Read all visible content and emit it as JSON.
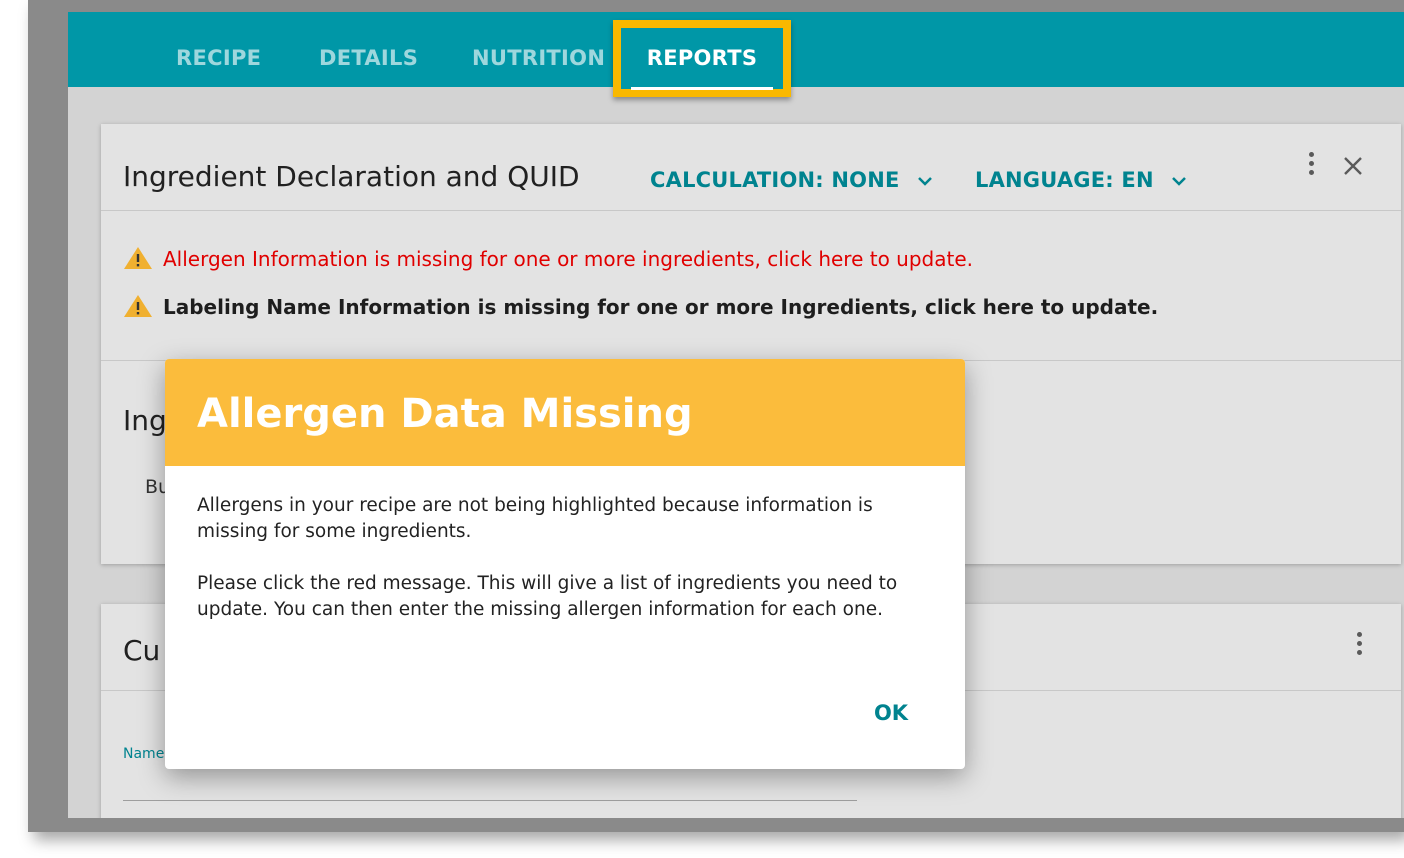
{
  "nav": {
    "tabs": [
      {
        "label": "RECIPE"
      },
      {
        "label": "DETAILS"
      },
      {
        "label": "NUTRITION"
      },
      {
        "label": "REPORTS"
      }
    ],
    "active_tab": "REPORTS"
  },
  "report_card": {
    "title": "Ingredient Declaration and QUID",
    "calculation_label": "CALCULATION: NONE",
    "language_label": "LANGUAGE: EN",
    "warnings": [
      {
        "text": "Allergen Information is missing for one or more ingredients, click here to update.",
        "color": "#e00000"
      },
      {
        "text": "Labeling Name Information is missing for one or more Ingredients, click here to update.",
        "color": "#1e1e1e"
      }
    ],
    "section_title_partial": "Ing",
    "section_text_partial": "Bu"
  },
  "custom_card": {
    "title_partial": "Cu",
    "field_label_partial": "Name"
  },
  "dialog": {
    "title": "Allergen Data Missing",
    "paragraph1": "Allergens in your recipe are not being highlighted because information is missing for some ingredients.",
    "paragraph2": "Please click the red message. This will give a list of ingredients you need to update. You can then enter the missing allergen information for each one.",
    "ok_label": "OK",
    "header_color": "#fbbc3c"
  },
  "colors": {
    "topbar": "#0097a7",
    "highlight": "#f9b800",
    "accent_text": "#00838f"
  },
  "icons": [
    "warning-triangle-icon",
    "chevron-down-icon",
    "more-vert-icon",
    "close-icon"
  ]
}
